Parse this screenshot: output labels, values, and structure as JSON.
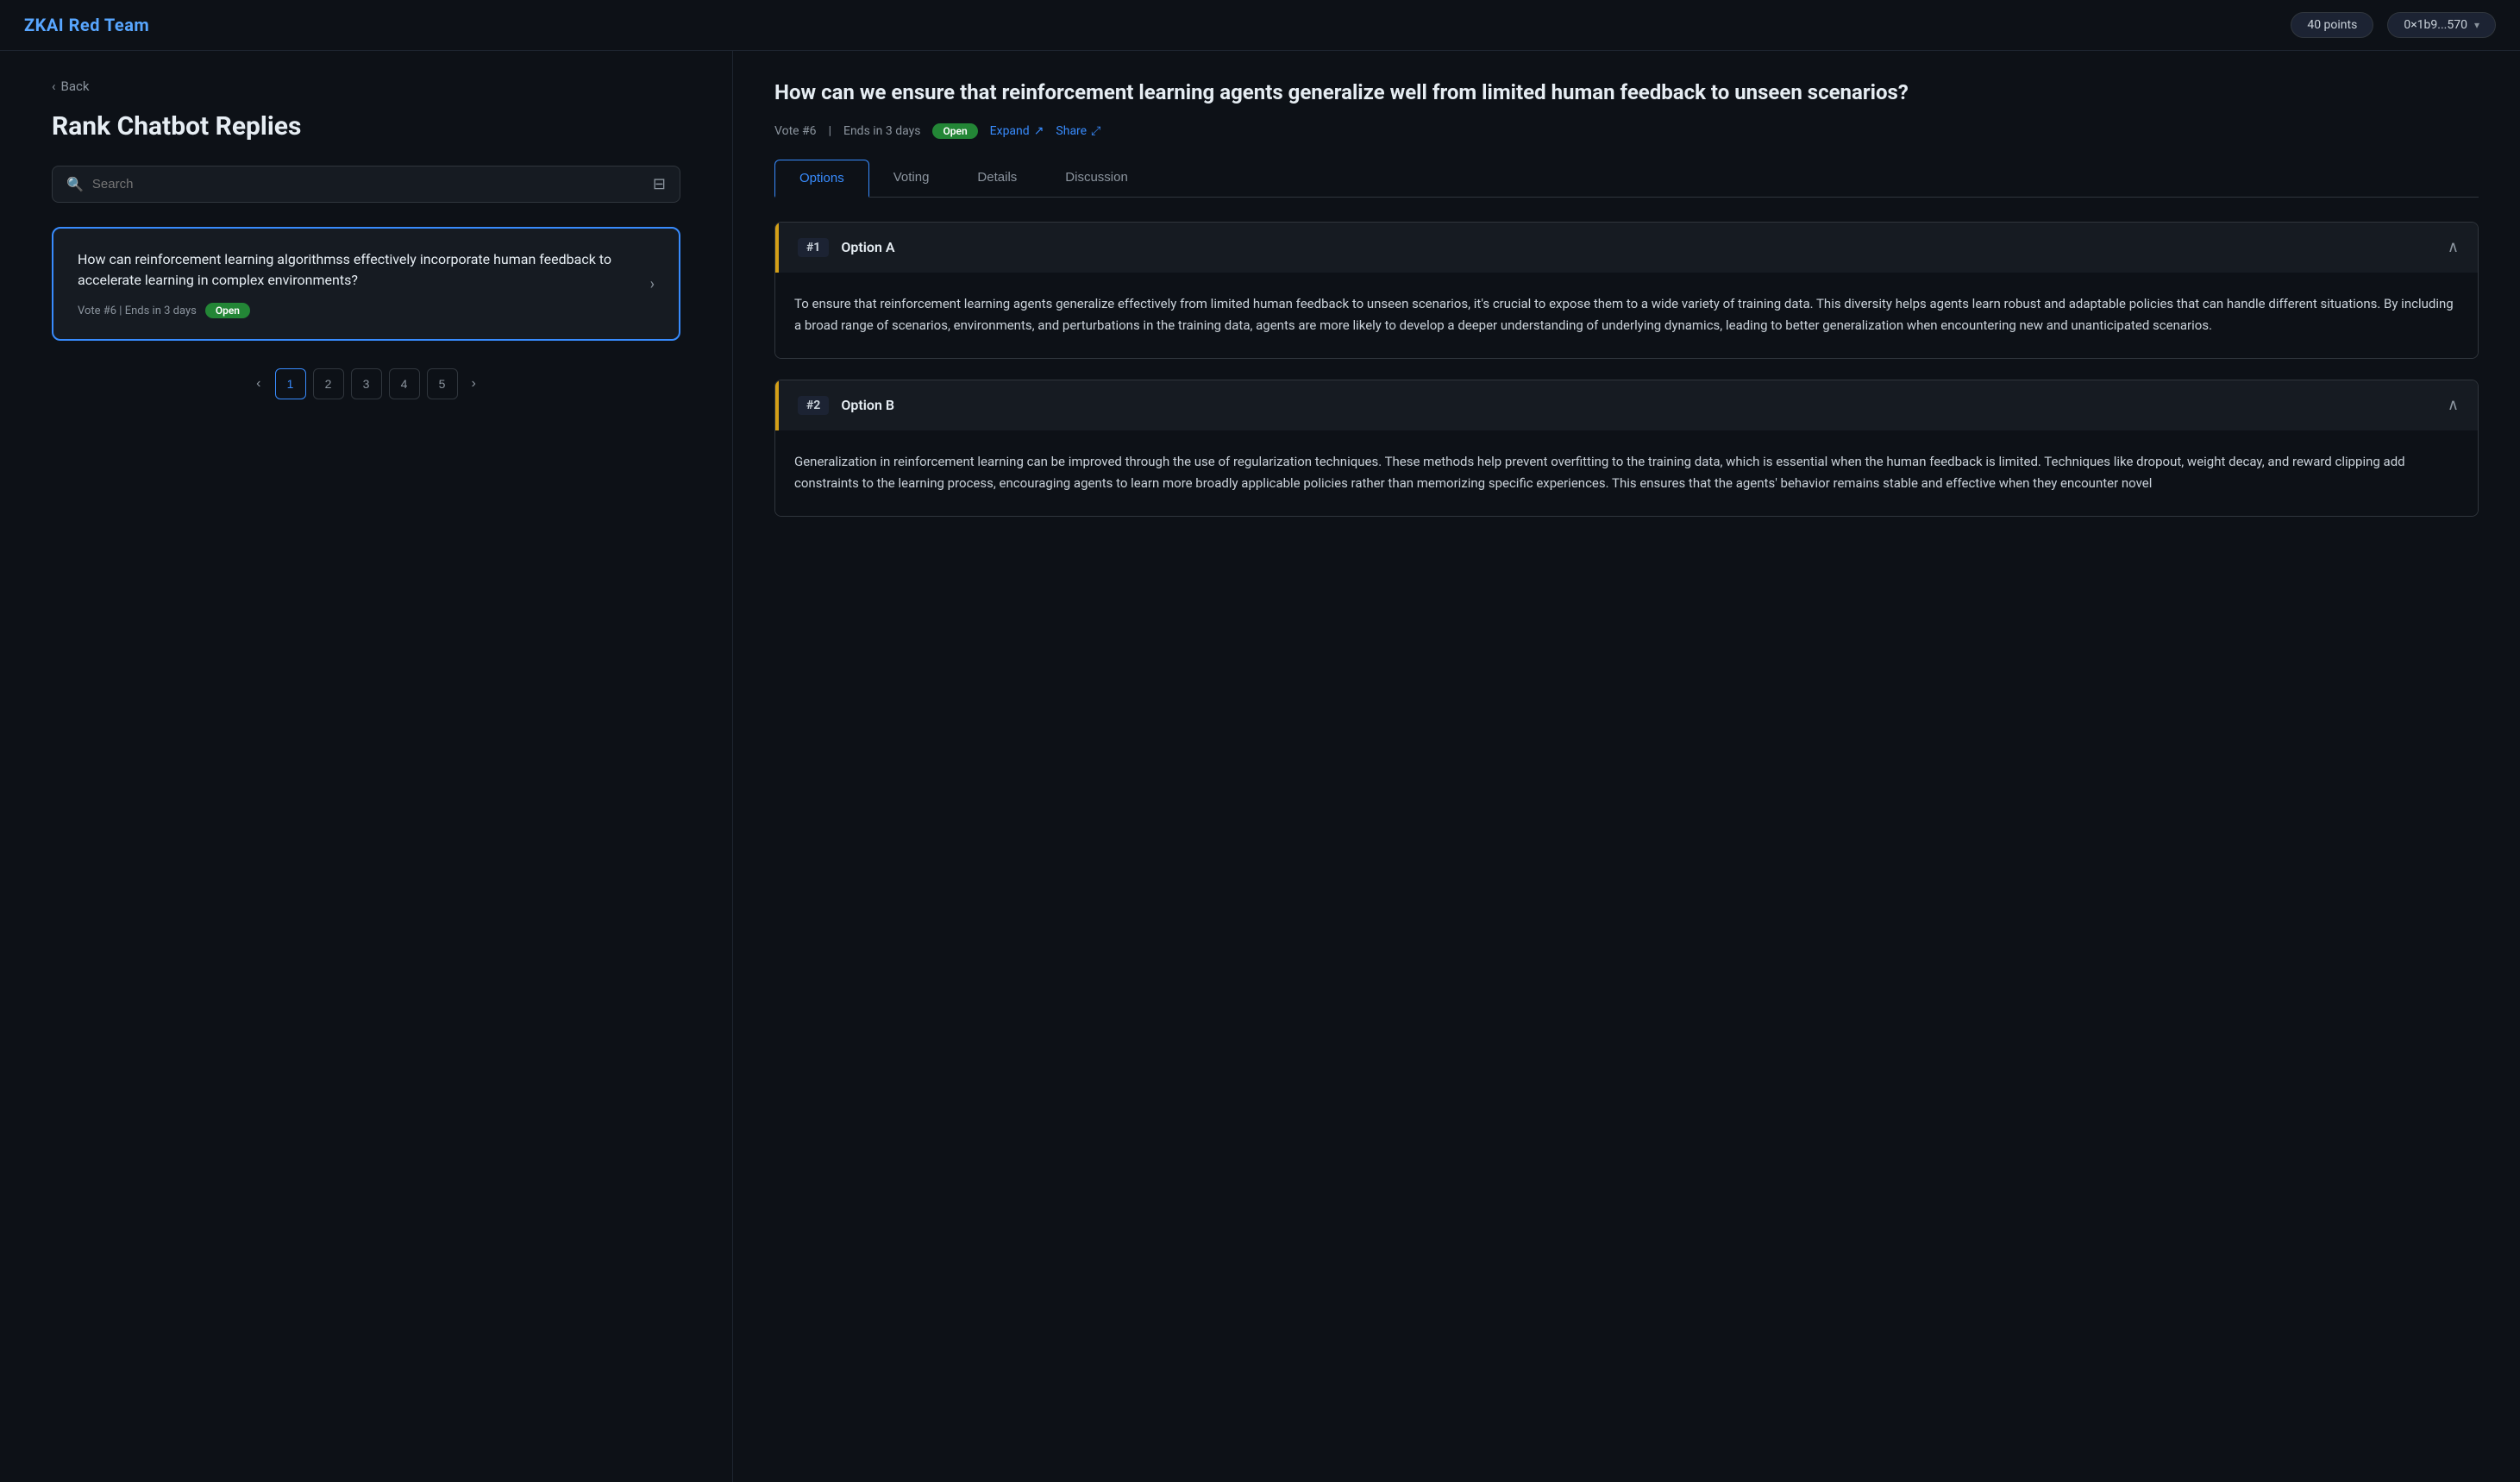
{
  "header": {
    "brand": "ZKAI Red Team",
    "points": "40 points",
    "wallet": "0×1b9...570"
  },
  "left": {
    "back_label": "Back",
    "page_title": "Rank Chatbot Replies",
    "search_placeholder": "Search",
    "question_card": {
      "text": "How can reinforcement learning algorithmss effectively incorporate human feedback to accelerate learning in complex environments?",
      "meta": "Vote #6 | Ends in 3 days",
      "status": "Open"
    },
    "pagination": {
      "pages": [
        "1",
        "2",
        "3",
        "4",
        "5"
      ],
      "current": "1"
    }
  },
  "right": {
    "question_title": "How can we ensure that reinforcement learning agents generalize well from limited human feedback to unseen scenarios?",
    "vote_meta": "Vote #6",
    "ends": "Ends in 3 days",
    "status": "Open",
    "expand_label": "Expand",
    "share_label": "Share",
    "tabs": [
      "Options",
      "Voting",
      "Details",
      "Discussion"
    ],
    "active_tab": "Options",
    "options": [
      {
        "number": "#1",
        "title": "Option A",
        "body": "To ensure that reinforcement learning agents generalize effectively from limited human feedback to unseen scenarios, it's crucial to expose them to a wide variety of training data. This diversity helps agents learn robust and adaptable policies that can handle different situations. By including a broad range of scenarios, environments, and perturbations in the training data, agents are more likely to develop a deeper understanding of underlying dynamics, leading to better generalization when encountering new and unanticipated scenarios."
      },
      {
        "number": "#2",
        "title": "Option B",
        "body": "Generalization in reinforcement learning can be improved through the use of regularization techniques. These methods help prevent overfitting to the training data, which is essential when the human feedback is limited. Techniques like dropout, weight decay, and reward clipping add constraints to the learning process, encouraging agents to learn more broadly applicable policies rather than memorizing specific experiences. This ensures that the agents' behavior remains stable and effective when they encounter novel"
      }
    ]
  }
}
